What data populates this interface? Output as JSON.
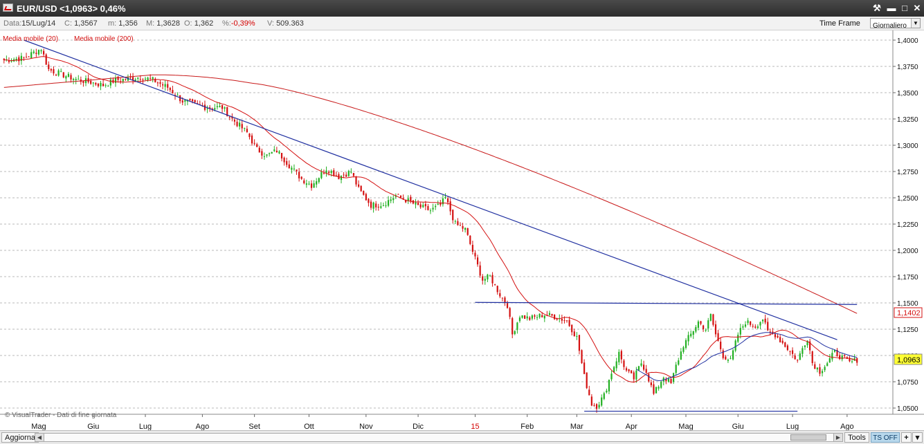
{
  "window": {
    "title": "EUR/USD <1,0963> 0,46%",
    "buttons": {
      "tool": "⚒",
      "minimize": "▬",
      "maximize": "□",
      "close": "✕"
    }
  },
  "info": {
    "date_label": "Data:",
    "date_value": "15/Lug/14",
    "close_label": "C:",
    "close_value": "1,3567",
    "min_label": "m:",
    "min_value": "1,356",
    "max_label": "M:",
    "max_value": "1,3628",
    "open_label": "O:",
    "open_value": "1,362",
    "pct_label": "%:",
    "pct_value": "-0,39%",
    "vol_label": "V:",
    "vol_value": "509.363",
    "timeframe_label": "Time Frame",
    "timeframe_value": "Giornaliero"
  },
  "chart": {
    "legend_ma20": "Media mobile (20)",
    "legend_ma200": "Media mobile (200)",
    "watermark": "© VisualTrader - Dati di fine giornata",
    "price_badge_red": "1,1402",
    "price_badge_last": "1,0963",
    "colors": {
      "up": "#22b022",
      "down": "#d41010",
      "ma20": "#d41010",
      "ma200": "#c81818",
      "trendline": "#1f2fa0",
      "ma_blue": "#1f2fa0",
      "grid": "#b8b8b8",
      "last_badge": "#ffff33"
    }
  },
  "chart_data": {
    "type": "candlestick",
    "y_ticks": [
      "1,4000",
      "1,3750",
      "1,3500",
      "1,3250",
      "1,3000",
      "1,2750",
      "1,2500",
      "1,2250",
      "1,2000",
      "1,1750",
      "1,1500",
      "1,1250",
      "1,1000",
      "1,0750",
      "1,0500"
    ],
    "ylim": [
      1.042,
      1.405
    ],
    "x_ticks": [
      {
        "label": "Mag",
        "i": 14,
        "red": false
      },
      {
        "label": "Giu",
        "i": 36,
        "red": false
      },
      {
        "label": "Lug",
        "i": 57,
        "red": false
      },
      {
        "label": "Ago",
        "i": 80,
        "red": false
      },
      {
        "label": "Set",
        "i": 101,
        "red": false
      },
      {
        "label": "Ott",
        "i": 123,
        "red": false
      },
      {
        "label": "Nov",
        "i": 146,
        "red": false
      },
      {
        "label": "Dic",
        "i": 167,
        "red": false
      },
      {
        "label": "15",
        "i": 190,
        "red": true
      },
      {
        "label": "Feb",
        "i": 211,
        "red": false
      },
      {
        "label": "Mar",
        "i": 231,
        "red": false
      },
      {
        "label": "Apr",
        "i": 253,
        "red": false
      },
      {
        "label": "Mag",
        "i": 275,
        "red": false
      },
      {
        "label": "Giu",
        "i": 296,
        "red": false
      },
      {
        "label": "Lug",
        "i": 318,
        "red": false
      },
      {
        "label": "Ago",
        "i": 340,
        "red": false
      }
    ],
    "n_bars": 345,
    "close_anchors": [
      [
        0,
        1.381
      ],
      [
        8,
        1.383
      ],
      [
        15,
        1.392
      ],
      [
        18,
        1.372
      ],
      [
        25,
        1.366
      ],
      [
        30,
        1.362
      ],
      [
        35,
        1.36
      ],
      [
        40,
        1.357
      ],
      [
        45,
        1.362
      ],
      [
        50,
        1.363
      ],
      [
        55,
        1.365
      ],
      [
        60,
        1.362
      ],
      [
        66,
        1.355
      ],
      [
        72,
        1.342
      ],
      [
        78,
        1.338
      ],
      [
        82,
        1.336
      ],
      [
        88,
        1.336
      ],
      [
        92,
        1.325
      ],
      [
        98,
        1.312
      ],
      [
        102,
        1.296
      ],
      [
        106,
        1.29
      ],
      [
        110,
        1.295
      ],
      [
        115,
        1.281
      ],
      [
        120,
        1.268
      ],
      [
        124,
        1.262
      ],
      [
        130,
        1.278
      ],
      [
        135,
        1.27
      ],
      [
        140,
        1.275
      ],
      [
        143,
        1.258
      ],
      [
        148,
        1.243
      ],
      [
        153,
        1.244
      ],
      [
        158,
        1.252
      ],
      [
        163,
        1.247
      ],
      [
        167,
        1.242
      ],
      [
        172,
        1.238
      ],
      [
        176,
        1.243
      ],
      [
        178,
        1.25
      ],
      [
        182,
        1.225
      ],
      [
        186,
        1.22
      ],
      [
        190,
        1.192
      ],
      [
        193,
        1.172
      ],
      [
        196,
        1.175
      ],
      [
        200,
        1.158
      ],
      [
        203,
        1.148
      ],
      [
        205,
        1.12
      ],
      [
        208,
        1.138
      ],
      [
        212,
        1.135
      ],
      [
        215,
        1.137
      ],
      [
        218,
        1.139
      ],
      [
        222,
        1.137
      ],
      [
        227,
        1.133
      ],
      [
        231,
        1.117
      ],
      [
        234,
        1.08
      ],
      [
        237,
        1.054
      ],
      [
        239,
        1.052
      ],
      [
        242,
        1.062
      ],
      [
        245,
        1.084
      ],
      [
        248,
        1.102
      ],
      [
        251,
        1.085
      ],
      [
        254,
        1.078
      ],
      [
        257,
        1.093
      ],
      [
        259,
        1.085
      ],
      [
        262,
        1.063
      ],
      [
        266,
        1.08
      ],
      [
        269,
        1.073
      ],
      [
        271,
        1.09
      ],
      [
        274,
        1.11
      ],
      [
        277,
        1.12
      ],
      [
        280,
        1.132
      ],
      [
        283,
        1.125
      ],
      [
        285,
        1.138
      ],
      [
        287,
        1.12
      ],
      [
        290,
        1.1
      ],
      [
        293,
        1.095
      ],
      [
        296,
        1.12
      ],
      [
        299,
        1.132
      ],
      [
        303,
        1.128
      ],
      [
        306,
        1.135
      ],
      [
        308,
        1.122
      ],
      [
        311,
        1.12
      ],
      [
        314,
        1.112
      ],
      [
        317,
        1.104
      ],
      [
        320,
        1.095
      ],
      [
        322,
        1.107
      ],
      [
        324,
        1.117
      ],
      [
        326,
        1.093
      ],
      [
        329,
        1.085
      ],
      [
        332,
        1.093
      ],
      [
        335,
        1.103
      ],
      [
        338,
        1.098
      ],
      [
        341,
        1.093
      ],
      [
        344,
        1.096
      ]
    ],
    "lines": [
      {
        "name": "trendline-upper",
        "points": [
          [
            8,
            1.4
          ],
          [
            336,
            1.115
          ]
        ]
      },
      {
        "name": "resistance-1150",
        "points": [
          [
            190,
            1.1505
          ],
          [
            344,
            1.1485
          ]
        ]
      },
      {
        "name": "support-1047",
        "points": [
          [
            234,
            1.047
          ],
          [
            320,
            1.047
          ]
        ]
      }
    ]
  }
}
